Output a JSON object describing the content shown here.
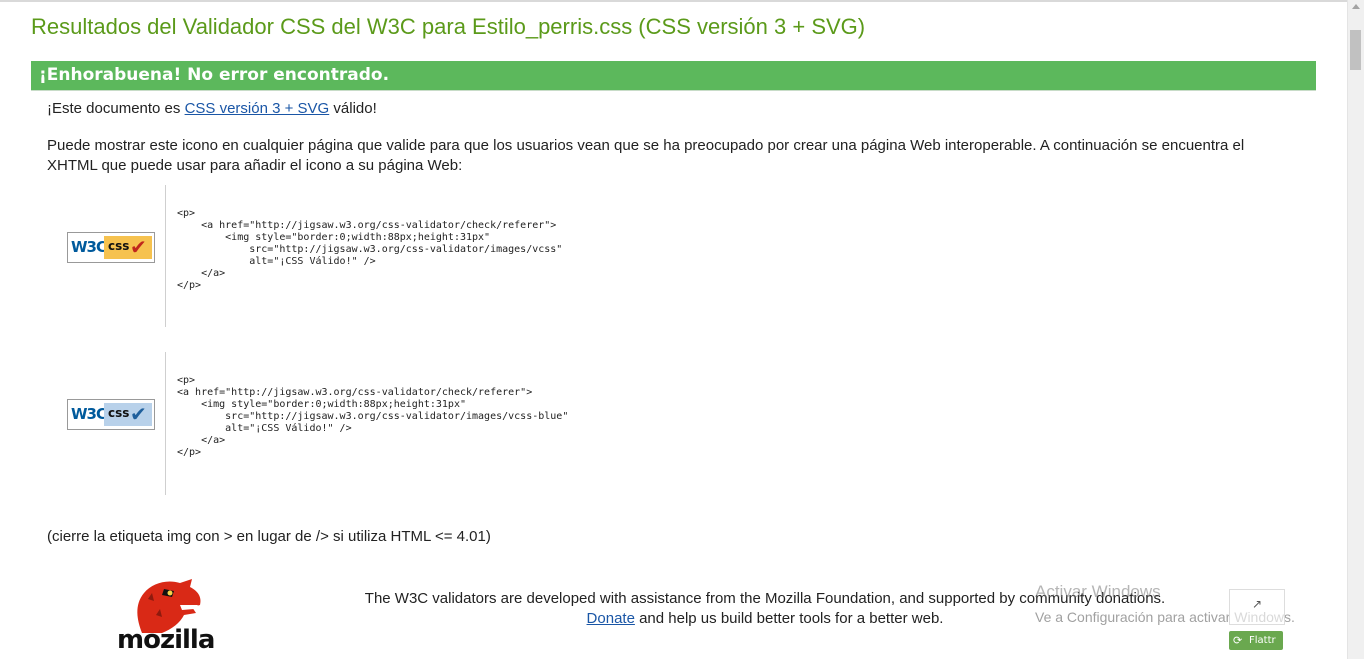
{
  "title": "Resultados del Validador CSS del W3C para Estilo_perris.css (CSS versión 3 + SVG)",
  "success_message": "¡Enhorabuena! No error encontrado.",
  "valid_sentence": {
    "prefix": "¡Este documento es ",
    "link_text": "CSS versión 3 + SVG",
    "suffix": " válido!"
  },
  "info_paragraph": "Puede mostrar este icono en cualquier página que valide para que los usuarios vean que se ha preocupado por crear una página Web interoperable. A continuación se encuentra el XHTML que puede usar para añadir el icono a su página Web:",
  "badges": [
    {
      "name": "vcss",
      "w3c_text": "W3C",
      "css_text": "css",
      "css_bg": "#f6c24f",
      "check_color": "#c0261c",
      "code": "<p>\n    <a href=\"http://jigsaw.w3.org/css-validator/check/referer\">\n        <img style=\"border:0;width:88px;height:31px\"\n            src=\"http://jigsaw.w3.org/css-validator/images/vcss\"\n            alt=\"¡CSS Válido!\" />\n    </a>\n</p>"
    },
    {
      "name": "vcss-blue",
      "w3c_text": "W3C",
      "css_text": "css",
      "css_bg": "#b8d1ea",
      "check_color": "#1f5f9c",
      "code": "<p>\n<a href=\"http://jigsaw.w3.org/css-validator/check/referer\">\n    <img style=\"border:0;width:88px;height:31px\"\n        src=\"http://jigsaw.w3.org/css-validator/images/vcss-blue\"\n        alt=\"¡CSS Válido!\" />\n    </a>\n</p>"
    }
  ],
  "note": "(cierre la etiqueta img con > en lugar de /> si utiliza HTML <= 4.01)",
  "footer": {
    "logo_text": "mozilla",
    "line1": "The W3C validators are developed with assistance from the Mozilla Foundation, and supported by community donations.",
    "donate_link": "Donate",
    "line2_rest": " and help us build better tools for a better web."
  },
  "watermark": {
    "title": "Activar Windows",
    "subtitle": "Ve a Configuración para activar Windows."
  },
  "flattr_label": "Flattr",
  "colors": {
    "title_green": "#5b9a1a",
    "success_green": "#5cb85c",
    "link_blue": "#1a56a6"
  }
}
